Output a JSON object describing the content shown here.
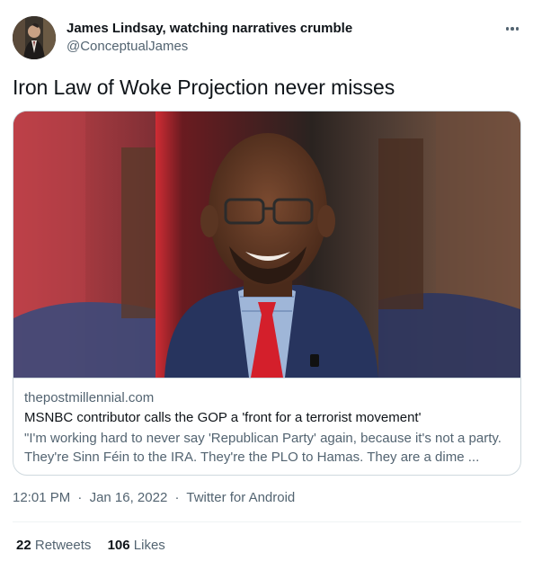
{
  "author": {
    "display_name": "James Lindsay, watching narratives crumble",
    "handle": "@ConceptualJames"
  },
  "tweet": {
    "text": "Iron Law of Woke Projection never misses"
  },
  "card": {
    "domain": "thepostmillennial.com",
    "title": "MSNBC contributor calls the GOP a 'front for a terrorist movement'",
    "description": "\"I'm working hard to never say 'Republican Party' again, because it's not a party. They're Sinn Féin to the IRA. They're the PLO to Hamas. They are a dime ..."
  },
  "meta": {
    "time": "12:01 PM",
    "date": "Jan 16, 2022",
    "source": "Twitter for Android",
    "separator": "·"
  },
  "stats": {
    "retweets_count": "22",
    "retweets_label": "Retweets",
    "likes_count": "106",
    "likes_label": "Likes"
  },
  "colors": {
    "text_primary": "#0f1419",
    "text_secondary": "#536471",
    "border": "#cfd9de",
    "divider": "#eff3f4"
  },
  "icons": {
    "more": "more-horizontal-icon"
  }
}
